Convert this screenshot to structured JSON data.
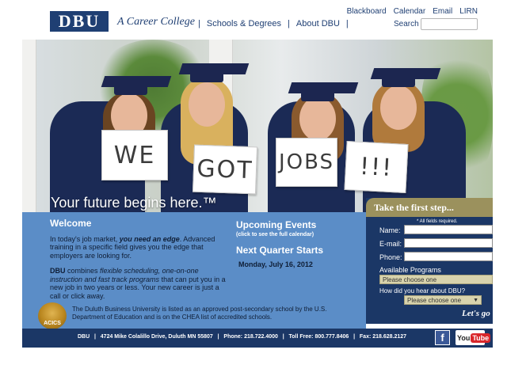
{
  "header": {
    "logo": "DBU",
    "tagline": "A Career College",
    "main_nav": [
      "Schools & Degrees",
      "About DBU"
    ],
    "utility_nav": [
      "Blackboard",
      "Calendar",
      "Email",
      "LIRN"
    ],
    "search_label": "Search"
  },
  "hero": {
    "signs": [
      "WE",
      "GOT",
      "JOBS",
      "!!!"
    ],
    "tagline": "Your future begins here.™"
  },
  "welcome": {
    "title": "Welcome",
    "p1_a": "In today's job market, ",
    "p1_b": "you need an edge",
    "p1_c": ". Advanced training in a specific field gives you the edge that employers are looking for.",
    "p2_a": "DBU",
    "p2_b": " combines ",
    "p2_c": "flexible scheduling, one-on-one instruction and fast track programs",
    "p2_d": " that can put you in a new job in two years or less. Your new career is just a call or click away."
  },
  "events": {
    "title": "Upcoming Events",
    "note": "(click to see the full calendar)",
    "next_title": "Next Quarter Starts",
    "next_date": "Monday, July 16, 2012"
  },
  "accreditation": {
    "seal": "ACICS",
    "text": "The Duluth Business University is listed as an approved post-secondary school by the U.S. Department of Education and is on the CHEA list of accredited schools."
  },
  "form": {
    "title": "Take the first step...",
    "required": "* All fields required.",
    "name_label": "Name:",
    "email_label": "E-mail:",
    "phone_label": "Phone:",
    "programs_label": "Available Programs",
    "programs_value": "Please choose one",
    "hear_label": "How did you hear about DBU?",
    "hear_value": "Please choose one",
    "submit": "Let's go"
  },
  "footer": {
    "address": "DBU   |   4724 Mike Colalillo Drive, Duluth MN 55807   |   Phone: 218.722.4000   |   Toll Free: 800.777.8406   |   Fax: 218.628.2127",
    "facebook": "f",
    "youtube_a": "You",
    "youtube_b": "Tube"
  },
  "colors": {
    "navy": "#1b3766",
    "panel_blue": "#5b8dc7",
    "form_tab": "#9b915d"
  }
}
